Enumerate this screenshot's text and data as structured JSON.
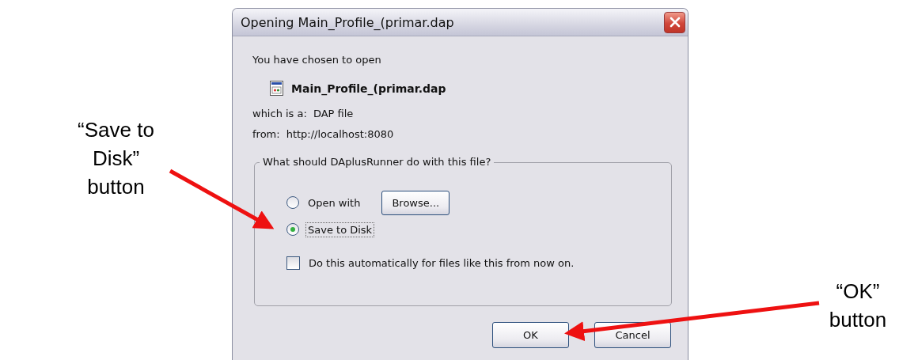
{
  "annotations": [
    {
      "text": "“Save to Disk” button"
    },
    {
      "text": "“OK” button"
    }
  ],
  "dialog": {
    "title": "Opening Main_Profile_(primar.dap",
    "intro": "You have chosen to open",
    "file_name": "Main_Profile_(primar.dap",
    "type_label": "which is a:",
    "type_value": "DAP file",
    "from_label": "from:",
    "from_value": "http://localhost:8080",
    "group_label": "What should DAplusRunner do with this file?",
    "options": [
      {
        "label": "Open with",
        "selected": false
      },
      {
        "label": "Save to Disk",
        "selected": true
      }
    ],
    "browse_button": "Browse...",
    "auto_checkbox": {
      "label": "Do this automatically for files like this from now on.",
      "checked": false
    },
    "buttons": [
      "OK",
      "Cancel"
    ]
  }
}
